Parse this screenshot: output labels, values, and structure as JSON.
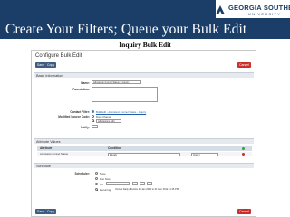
{
  "slide": {
    "title": "Create Your Filters; Queue your Bulk Edit",
    "subtitle": "Inquiry Bulk Edit",
    "logo_line1": "GEORGIA SOUTHERN",
    "logo_line2": "UNIVERSITY",
    "colors": {
      "header": "#1b3e68",
      "primary_button": "#3f5d80",
      "danger_button": "#c9302c"
    }
  },
  "app": {
    "page_title": "Configure Bulk Edit",
    "top_buttons": {
      "save": "Save",
      "copy": "Copy",
      "cancel": "Cancel"
    },
    "basic_info": {
      "section_label": "Basic Information",
      "name_label": "Name:",
      "name_value": "Admission Funnel Status = Inquiry",
      "description_label": "Description:",
      "contact_filter_label": "Contact Filter:",
      "contact_filter_text": "Bulk Edit - Admission Funnel Status - Inquiry",
      "modified_source_label": "Modified Source Code:",
      "modified_option_1": "Don't Change",
      "modified_option_2": "Admissions Edit",
      "notify_label": "Notify:"
    },
    "attribute_values": {
      "section_label": "Attribute Values",
      "col_attribute": "Attribute",
      "col_condition": "Condition",
      "row_attribute": "Admission Funnel Status",
      "row_operator": "Equals",
      "row_value": "Inquiry"
    },
    "schedule": {
      "section_label": "Schedule",
      "scheduler_label": "Scheduler:",
      "opt_none": "None",
      "opt_run_now": "Run Now",
      "opt_on": "On",
      "opt_recurring": "Recurring",
      "recurring_text": "Occurs Daily effective 25 Jan 2012 to 31 Dec 2012 11:15 PM"
    },
    "bottom_buttons": {
      "save": "Save",
      "copy": "Copy",
      "cancel": "Cancel"
    }
  }
}
